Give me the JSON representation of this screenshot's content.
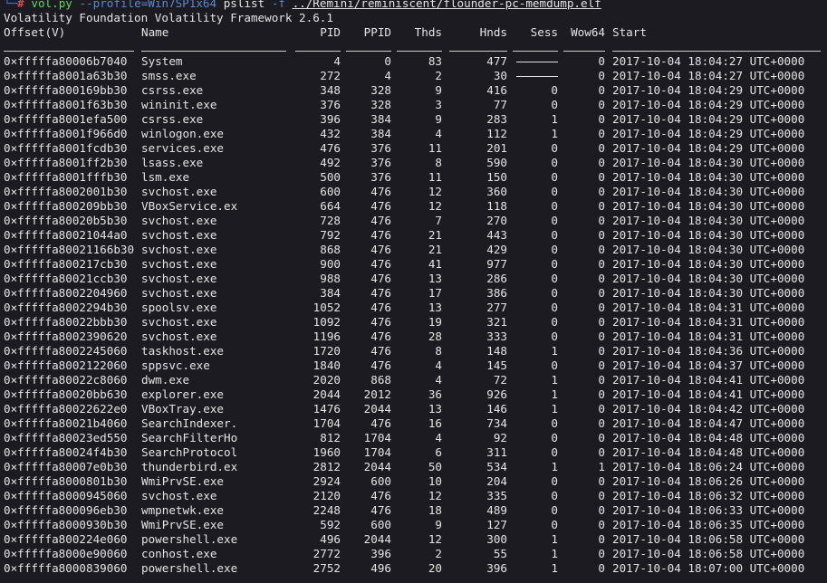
{
  "prompt": {
    "corner": "└─",
    "hash": "#",
    "command": "vol.py",
    "option_profile": "--profile=Win7SP1x64",
    "plugin": "pslist",
    "option_f": "-f",
    "file_path": "../Remini/reminiscent/flounder-pc-memdump.elf"
  },
  "banner": "Volatility Foundation Volatility Framework 2.6.1",
  "headers": {
    "offset": "Offset(V)",
    "name": "Name",
    "pid": "PID",
    "ppid": "PPID",
    "thds": "Thds",
    "hnds": "Hnds",
    "sess": "Sess",
    "wow64": "Wow64",
    "start": "Start"
  },
  "rows": [
    {
      "offset": "0×fffffa80006b7040",
      "name": "System",
      "pid": "4",
      "ppid": "0",
      "thds": "83",
      "hnds": "477",
      "sess": "",
      "wow64": "0",
      "start": "2017-10-04 18:04:27 UTC+0000"
    },
    {
      "offset": "0×fffffa8001a63b30",
      "name": "smss.exe",
      "pid": "272",
      "ppid": "4",
      "thds": "2",
      "hnds": "30",
      "sess": "",
      "wow64": "0",
      "start": "2017-10-04 18:04:27 UTC+0000"
    },
    {
      "offset": "0×fffffa800169bb30",
      "name": "csrss.exe",
      "pid": "348",
      "ppid": "328",
      "thds": "9",
      "hnds": "416",
      "sess": "0",
      "wow64": "0",
      "start": "2017-10-04 18:04:29 UTC+0000"
    },
    {
      "offset": "0×fffffa8001f63b30",
      "name": "wininit.exe",
      "pid": "376",
      "ppid": "328",
      "thds": "3",
      "hnds": "77",
      "sess": "0",
      "wow64": "0",
      "start": "2017-10-04 18:04:29 UTC+0000"
    },
    {
      "offset": "0×fffffa8001efa500",
      "name": "csrss.exe",
      "pid": "396",
      "ppid": "384",
      "thds": "9",
      "hnds": "283",
      "sess": "1",
      "wow64": "0",
      "start": "2017-10-04 18:04:29 UTC+0000"
    },
    {
      "offset": "0×fffffa8001f966d0",
      "name": "winlogon.exe",
      "pid": "432",
      "ppid": "384",
      "thds": "4",
      "hnds": "112",
      "sess": "1",
      "wow64": "0",
      "start": "2017-10-04 18:04:29 UTC+0000"
    },
    {
      "offset": "0×fffffa8001fcdb30",
      "name": "services.exe",
      "pid": "476",
      "ppid": "376",
      "thds": "11",
      "hnds": "201",
      "sess": "0",
      "wow64": "0",
      "start": "2017-10-04 18:04:29 UTC+0000"
    },
    {
      "offset": "0×fffffa8001ff2b30",
      "name": "lsass.exe",
      "pid": "492",
      "ppid": "376",
      "thds": "8",
      "hnds": "590",
      "sess": "0",
      "wow64": "0",
      "start": "2017-10-04 18:04:30 UTC+0000"
    },
    {
      "offset": "0×fffffa8001fffb30",
      "name": "lsm.exe",
      "pid": "500",
      "ppid": "376",
      "thds": "11",
      "hnds": "150",
      "sess": "0",
      "wow64": "0",
      "start": "2017-10-04 18:04:30 UTC+0000"
    },
    {
      "offset": "0×fffffa8002001b30",
      "name": "svchost.exe",
      "pid": "600",
      "ppid": "476",
      "thds": "12",
      "hnds": "360",
      "sess": "0",
      "wow64": "0",
      "start": "2017-10-04 18:04:30 UTC+0000"
    },
    {
      "offset": "0×fffffa800209bb30",
      "name": "VBoxService.ex",
      "pid": "664",
      "ppid": "476",
      "thds": "12",
      "hnds": "118",
      "sess": "0",
      "wow64": "0",
      "start": "2017-10-04 18:04:30 UTC+0000"
    },
    {
      "offset": "0×fffffa80020b5b30",
      "name": "svchost.exe",
      "pid": "728",
      "ppid": "476",
      "thds": "7",
      "hnds": "270",
      "sess": "0",
      "wow64": "0",
      "start": "2017-10-04 18:04:30 UTC+0000"
    },
    {
      "offset": "0×fffffa80021044a0",
      "name": "svchost.exe",
      "pid": "792",
      "ppid": "476",
      "thds": "21",
      "hnds": "443",
      "sess": "0",
      "wow64": "0",
      "start": "2017-10-04 18:04:30 UTC+0000"
    },
    {
      "offset": "0×fffffa80021166b30",
      "name": "svchost.exe",
      "pid": "868",
      "ppid": "476",
      "thds": "21",
      "hnds": "429",
      "sess": "0",
      "wow64": "0",
      "start": "2017-10-04 18:04:30 UTC+0000"
    },
    {
      "offset": "0×fffffa800217cb30",
      "name": "svchost.exe",
      "pid": "900",
      "ppid": "476",
      "thds": "41",
      "hnds": "977",
      "sess": "0",
      "wow64": "0",
      "start": "2017-10-04 18:04:30 UTC+0000"
    },
    {
      "offset": "0×fffffa80021ccb30",
      "name": "svchost.exe",
      "pid": "988",
      "ppid": "476",
      "thds": "13",
      "hnds": "286",
      "sess": "0",
      "wow64": "0",
      "start": "2017-10-04 18:04:30 UTC+0000"
    },
    {
      "offset": "0×fffffa8002204960",
      "name": "svchost.exe",
      "pid": "384",
      "ppid": "476",
      "thds": "17",
      "hnds": "386",
      "sess": "0",
      "wow64": "0",
      "start": "2017-10-04 18:04:30 UTC+0000"
    },
    {
      "offset": "0×fffffa8002294b30",
      "name": "spoolsv.exe",
      "pid": "1052",
      "ppid": "476",
      "thds": "13",
      "hnds": "277",
      "sess": "0",
      "wow64": "0",
      "start": "2017-10-04 18:04:31 UTC+0000"
    },
    {
      "offset": "0×fffffa80022bbb30",
      "name": "svchost.exe",
      "pid": "1092",
      "ppid": "476",
      "thds": "19",
      "hnds": "321",
      "sess": "0",
      "wow64": "0",
      "start": "2017-10-04 18:04:31 UTC+0000"
    },
    {
      "offset": "0×fffffa8002390620",
      "name": "svchost.exe",
      "pid": "1196",
      "ppid": "476",
      "thds": "28",
      "hnds": "333",
      "sess": "0",
      "wow64": "0",
      "start": "2017-10-04 18:04:31 UTC+0000"
    },
    {
      "offset": "0×fffffa8002245060",
      "name": "taskhost.exe",
      "pid": "1720",
      "ppid": "476",
      "thds": "8",
      "hnds": "148",
      "sess": "1",
      "wow64": "0",
      "start": "2017-10-04 18:04:36 UTC+0000"
    },
    {
      "offset": "0×fffffa8002122060",
      "name": "sppsvc.exe",
      "pid": "1840",
      "ppid": "476",
      "thds": "4",
      "hnds": "145",
      "sess": "0",
      "wow64": "0",
      "start": "2017-10-04 18:04:37 UTC+0000"
    },
    {
      "offset": "0×fffffa80022c8060",
      "name": "dwm.exe",
      "pid": "2020",
      "ppid": "868",
      "thds": "4",
      "hnds": "72",
      "sess": "1",
      "wow64": "0",
      "start": "2017-10-04 18:04:41 UTC+0000"
    },
    {
      "offset": "0×fffffa80020bb630",
      "name": "explorer.exe",
      "pid": "2044",
      "ppid": "2012",
      "thds": "36",
      "hnds": "926",
      "sess": "1",
      "wow64": "0",
      "start": "2017-10-04 18:04:41 UTC+0000"
    },
    {
      "offset": "0×fffffa80022622e0",
      "name": "VBoxTray.exe",
      "pid": "1476",
      "ppid": "2044",
      "thds": "13",
      "hnds": "146",
      "sess": "1",
      "wow64": "0",
      "start": "2017-10-04 18:04:42 UTC+0000"
    },
    {
      "offset": "0×fffffa80021b4060",
      "name": "SearchIndexer.",
      "pid": "1704",
      "ppid": "476",
      "thds": "16",
      "hnds": "734",
      "sess": "0",
      "wow64": "0",
      "start": "2017-10-04 18:04:47 UTC+0000"
    },
    {
      "offset": "0×fffffa80023ed550",
      "name": "SearchFilterHo",
      "pid": "812",
      "ppid": "1704",
      "thds": "4",
      "hnds": "92",
      "sess": "0",
      "wow64": "0",
      "start": "2017-10-04 18:04:48 UTC+0000"
    },
    {
      "offset": "0×fffffa80024f4b30",
      "name": "SearchProtocol",
      "pid": "1960",
      "ppid": "1704",
      "thds": "6",
      "hnds": "311",
      "sess": "0",
      "wow64": "0",
      "start": "2017-10-04 18:04:48 UTC+0000"
    },
    {
      "offset": "0×fffffa80007e0b30",
      "name": "thunderbird.ex",
      "pid": "2812",
      "ppid": "2044",
      "thds": "50",
      "hnds": "534",
      "sess": "1",
      "wow64": "1",
      "start": "2017-10-04 18:06:24 UTC+0000"
    },
    {
      "offset": "0×fffffa8000801b30",
      "name": "WmiPrvSE.exe",
      "pid": "2924",
      "ppid": "600",
      "thds": "10",
      "hnds": "204",
      "sess": "0",
      "wow64": "0",
      "start": "2017-10-04 18:06:26 UTC+0000"
    },
    {
      "offset": "0×fffffa8000945060",
      "name": "svchost.exe",
      "pid": "2120",
      "ppid": "476",
      "thds": "12",
      "hnds": "335",
      "sess": "0",
      "wow64": "0",
      "start": "2017-10-04 18:06:32 UTC+0000"
    },
    {
      "offset": "0×fffffa800096eb30",
      "name": "wmpnetwk.exe",
      "pid": "2248",
      "ppid": "476",
      "thds": "18",
      "hnds": "489",
      "sess": "0",
      "wow64": "0",
      "start": "2017-10-04 18:06:33 UTC+0000"
    },
    {
      "offset": "0×fffffa8000930b30",
      "name": "WmiPrvSE.exe",
      "pid": "592",
      "ppid": "600",
      "thds": "9",
      "hnds": "127",
      "sess": "0",
      "wow64": "0",
      "start": "2017-10-04 18:06:35 UTC+0000"
    },
    {
      "offset": "0×fffffa800224e060",
      "name": "powershell.exe",
      "pid": "496",
      "ppid": "2044",
      "thds": "12",
      "hnds": "300",
      "sess": "1",
      "wow64": "0",
      "start": "2017-10-04 18:06:58 UTC+0000"
    },
    {
      "offset": "0×fffffa8000e90060",
      "name": "conhost.exe",
      "pid": "2772",
      "ppid": "396",
      "thds": "2",
      "hnds": "55",
      "sess": "1",
      "wow64": "0",
      "start": "2017-10-04 18:06:58 UTC+0000"
    },
    {
      "offset": "0×fffffa8000839060",
      "name": "powershell.exe",
      "pid": "2752",
      "ppid": "496",
      "thds": "20",
      "hnds": "396",
      "sess": "1",
      "wow64": "0",
      "start": "2017-10-04 18:07:00 UTC+0000"
    }
  ]
}
